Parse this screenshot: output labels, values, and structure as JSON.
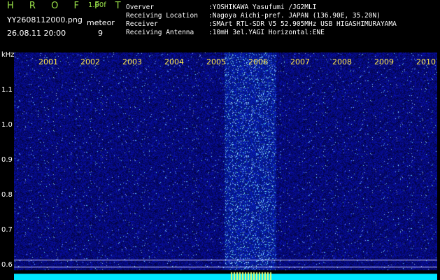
{
  "header": {
    "app_title": "H R O F F T",
    "app_version": "1.00f",
    "filename": "YY2608112000.png",
    "timestamp": "26.08.11 20:00",
    "meteor_label": "meteor",
    "meteor_count": "9"
  },
  "info": [
    {
      "key": "Overver",
      "value": ":YOSHIKAWA Yasufumi /JG2MLI"
    },
    {
      "key": "Receiving Location",
      "value": ":Nagoya Aichi-pref. JAPAN (136.90E, 35.20N)"
    },
    {
      "key": "Receiver",
      "value": ":SMArt RTL-SDR V5 52.905MHz USB HIGASHIMURAYAMA"
    },
    {
      "key": "Receiving Antenna",
      "value": ":10mH 3el.YAGI Horizontal:ENE"
    }
  ],
  "spectrogram": {
    "y_unit": "kHz",
    "y_ticks": [
      "1.1",
      "1.0",
      "0.9",
      "0.8",
      "0.7",
      "0.6"
    ],
    "minute_labels": [
      "2001",
      "2002",
      "2003",
      "2004",
      "2005",
      "2006",
      "2007",
      "2008",
      "2009",
      "2010"
    ],
    "colors": {
      "background": "#000000",
      "noise": "#1a2fb0",
      "signal": "#7fd8ff",
      "trace": "#00e6ff",
      "year_label": "#ffe94a",
      "title": "#9be34a"
    }
  }
}
